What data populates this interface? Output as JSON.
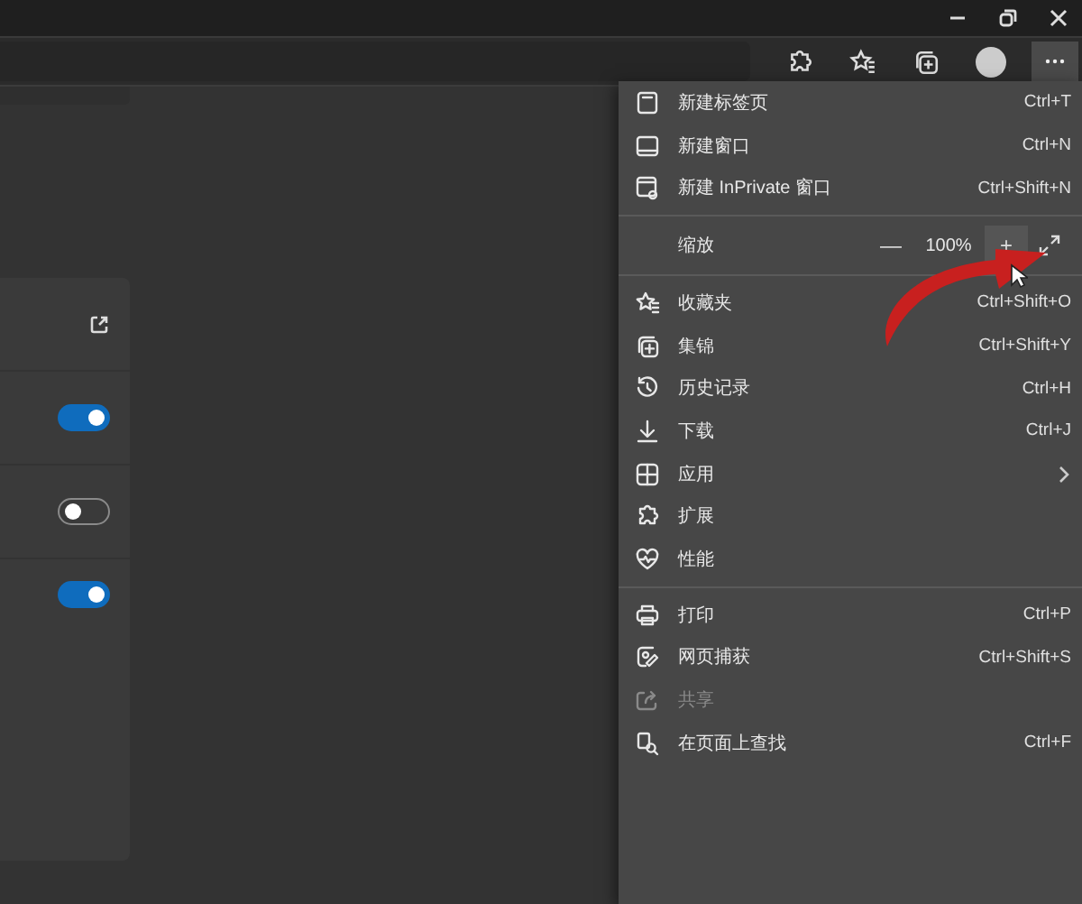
{
  "settings_rows": [
    {
      "kind": "link"
    },
    {
      "kind": "toggle",
      "on": true
    },
    {
      "kind": "toggle",
      "on": false
    },
    {
      "kind": "toggle",
      "on": true
    }
  ],
  "menu": {
    "items": [
      {
        "kind": "item",
        "label": "新建标签页",
        "shortcut": "Ctrl+T",
        "disabled": false,
        "submenu": false
      },
      {
        "kind": "item",
        "label": "新建窗口",
        "shortcut": "Ctrl+N",
        "disabled": false,
        "submenu": false
      },
      {
        "kind": "item",
        "label": "新建 InPrivate 窗口",
        "shortcut": "Ctrl+Shift+N",
        "disabled": false,
        "submenu": false
      },
      {
        "kind": "divider"
      },
      {
        "kind": "zoom",
        "label": "缩放",
        "minus": "—",
        "value": "100%",
        "plus": "+"
      },
      {
        "kind": "divider"
      },
      {
        "kind": "item",
        "label": "收藏夹",
        "shortcut": "Ctrl+Shift+O",
        "disabled": false,
        "submenu": false
      },
      {
        "kind": "item",
        "label": "集锦",
        "shortcut": "Ctrl+Shift+Y",
        "disabled": false,
        "submenu": false
      },
      {
        "kind": "item",
        "label": "历史记录",
        "shortcut": "Ctrl+H",
        "disabled": false,
        "submenu": false
      },
      {
        "kind": "item",
        "label": "下载",
        "shortcut": "Ctrl+J",
        "disabled": false,
        "submenu": false
      },
      {
        "kind": "item",
        "label": "应用",
        "disabled": false,
        "submenu": true
      },
      {
        "kind": "item",
        "label": "扩展",
        "disabled": false,
        "submenu": false
      },
      {
        "kind": "item",
        "label": "性能",
        "disabled": false,
        "submenu": false
      },
      {
        "kind": "divider"
      },
      {
        "kind": "item",
        "label": "打印",
        "shortcut": "Ctrl+P",
        "disabled": false,
        "submenu": false
      },
      {
        "kind": "item",
        "label": "网页捕获",
        "shortcut": "Ctrl+Shift+S",
        "disabled": false,
        "submenu": false
      },
      {
        "kind": "item",
        "label": "共享",
        "disabled": true,
        "submenu": false
      },
      {
        "kind": "item",
        "label": "在页面上查找",
        "shortcut": "Ctrl+F",
        "disabled": false,
        "submenu": false
      }
    ]
  }
}
